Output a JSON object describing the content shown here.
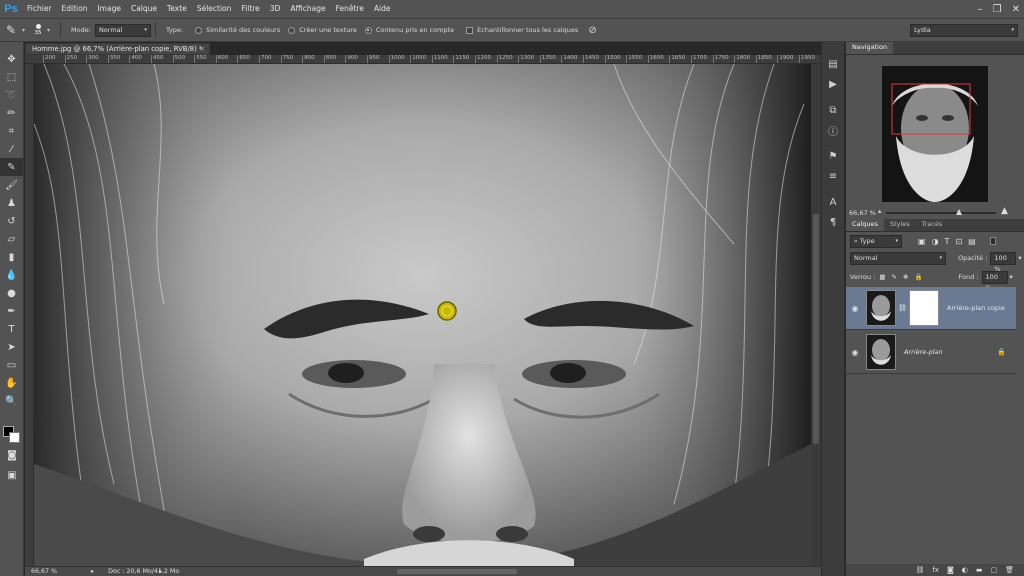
{
  "app": {
    "logo": "Ps"
  },
  "menu": [
    "Fichier",
    "Edition",
    "Image",
    "Calque",
    "Texte",
    "Sélection",
    "Filtre",
    "3D",
    "Affichage",
    "Fenêtre",
    "Aide"
  ],
  "window_controls": {
    "minimize": "–",
    "restore": "❐",
    "close": "✕"
  },
  "options": {
    "brush_size": "35",
    "mode_label": "Mode:",
    "mode_value": "Normal",
    "type_label": "Type:",
    "radio_similarity": "Similarité des couleurs",
    "radio_texture": "Créer une texture",
    "radio_content_aware": "Contenu pris en compte",
    "checkbox_sample_all": "Echantillonner tous les calques",
    "workspace": "Lydia"
  },
  "document": {
    "tab_title": "Homme.jpg @ 66,7% (Arrière-plan copie, RVB/8) *",
    "ruler_ticks": [
      "200",
      "250",
      "300",
      "350",
      "400",
      "450",
      "500",
      "550",
      "600",
      "650",
      "700",
      "750",
      "800",
      "850",
      "900",
      "950",
      "1000",
      "1050",
      "1100",
      "1150",
      "1200",
      "1250",
      "1300",
      "1350",
      "1400",
      "1450",
      "1500",
      "1550",
      "1600",
      "1650",
      "1700",
      "1750",
      "1800",
      "1850",
      "1900",
      "1950"
    ],
    "status_zoom": "66,67 %",
    "status_doc": "Doc : 20,6 Mo/41,2 Mo"
  },
  "navigator": {
    "tab": "Navigation",
    "zoom": "66,67 %"
  },
  "layers_panel": {
    "tabs": [
      "Calques",
      "Styles",
      "Tracés"
    ],
    "filter": "Type",
    "blend_mode": "Normal",
    "opacity_label": "Opacité :",
    "opacity_value": "100 %",
    "lock_label": "Verrou :",
    "fill_label": "Fond :",
    "fill_value": "100 %",
    "layers": [
      {
        "name": "Arrière-plan copie",
        "selected": true,
        "has_mask": true
      },
      {
        "name": "Arrière-plan",
        "selected": false,
        "locked": true
      }
    ]
  },
  "colors": {
    "foreground": "#000000",
    "background": "#ffffff",
    "accent": "#2fa3f0",
    "layer_selected": "#6b7a93"
  }
}
